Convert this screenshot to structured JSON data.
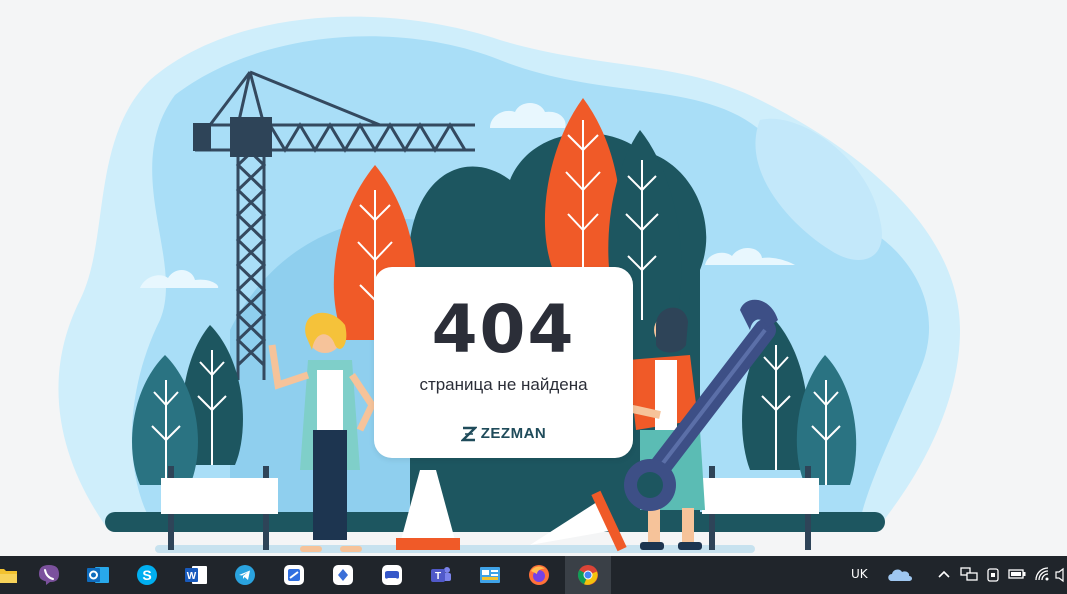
{
  "error_page": {
    "code": "404",
    "message": "страница не найдена",
    "brand": "ZEZMAN"
  },
  "colors": {
    "blob": "#cfeefb",
    "sky": "#a6dcf6",
    "dark_teal": "#1d5660",
    "teal": "#2a7382",
    "orange": "#f05a28",
    "crane": "#34495f",
    "taskbar": "#20252b"
  },
  "taskbar": {
    "apps": [
      {
        "name": "file-explorer",
        "icon": "folder-icon"
      },
      {
        "name": "viber",
        "icon": "viber-icon"
      },
      {
        "name": "outlook",
        "icon": "outlook-icon"
      },
      {
        "name": "skype",
        "icon": "skype-icon"
      },
      {
        "name": "word",
        "icon": "word-icon"
      },
      {
        "name": "telegram",
        "icon": "telegram-icon"
      },
      {
        "name": "app-blue",
        "icon": "app-icon"
      },
      {
        "name": "app-diamond",
        "icon": "app-icon"
      },
      {
        "name": "gamepad",
        "icon": "gamepad-icon"
      },
      {
        "name": "teams",
        "icon": "teams-icon"
      },
      {
        "name": "control-panel",
        "icon": "control-panel-icon"
      },
      {
        "name": "firefox",
        "icon": "firefox-icon"
      },
      {
        "name": "chrome",
        "icon": "chrome-icon"
      }
    ],
    "tray": {
      "language": "UK"
    }
  }
}
